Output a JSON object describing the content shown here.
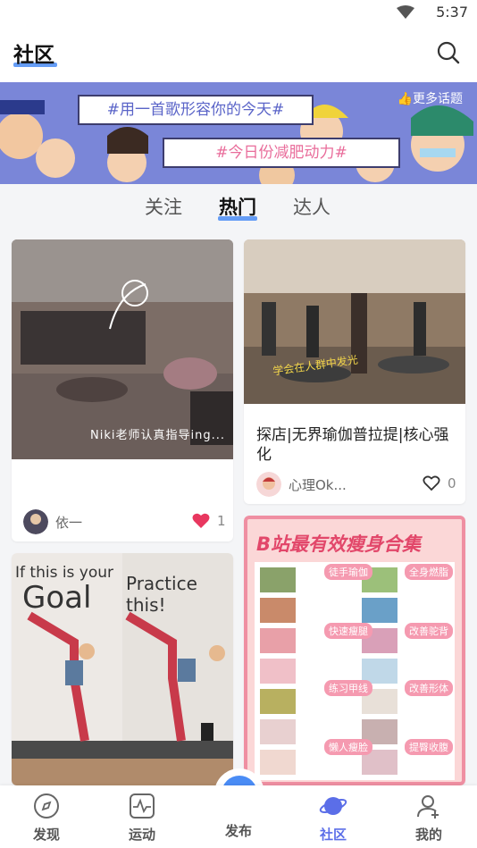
{
  "status_bar": {
    "time": "5:37"
  },
  "header": {
    "title": "社区",
    "search_icon": "search-icon"
  },
  "banner": {
    "topic_1": "#用一首歌形容你的今天#",
    "topic_2": "#今日份减肥动力#",
    "more_topics": "更多话题"
  },
  "tabs": [
    {
      "label": "关注",
      "active": false
    },
    {
      "label": "热门",
      "active": true
    },
    {
      "label": "达人",
      "active": false
    }
  ],
  "posts": [
    {
      "image_text": "Niki老师认真指导ing...",
      "caption": "",
      "user": "依一",
      "likes": "1",
      "liked": true
    },
    {
      "image_text": "学会在人群中发光",
      "caption": "探店|无界瑜伽普拉提|核心强化",
      "user": "心理Ok...",
      "likes": "0",
      "liked": false
    },
    {
      "image_text_left": "If this is your",
      "image_text_goal": "Goal",
      "image_text_right": "Practice this!",
      "caption": "",
      "user": "",
      "likes": ""
    },
    {
      "image_title": "B站最有效瘦身合集",
      "tags": [
        "徒手瑜伽",
        "全身燃脂",
        "快速瘦腿",
        "改善驼背",
        "练习甲线",
        "改善形体",
        "懒人瘦脸",
        "提臀收腹"
      ]
    }
  ],
  "bottom_nav": [
    {
      "label": "发现",
      "icon": "compass-icon",
      "active": false
    },
    {
      "label": "运动",
      "icon": "pulse-icon",
      "active": false
    },
    {
      "label": "发布",
      "icon": "plus-icon",
      "active": false
    },
    {
      "label": "社区",
      "icon": "planet-icon",
      "active": true
    },
    {
      "label": "我的",
      "icon": "profile-icon",
      "active": false
    }
  ],
  "colors": {
    "accent": "#5b6ee8",
    "underline": "#4a8cf5",
    "like": "#e8375f",
    "banner": "#7a86d8"
  }
}
